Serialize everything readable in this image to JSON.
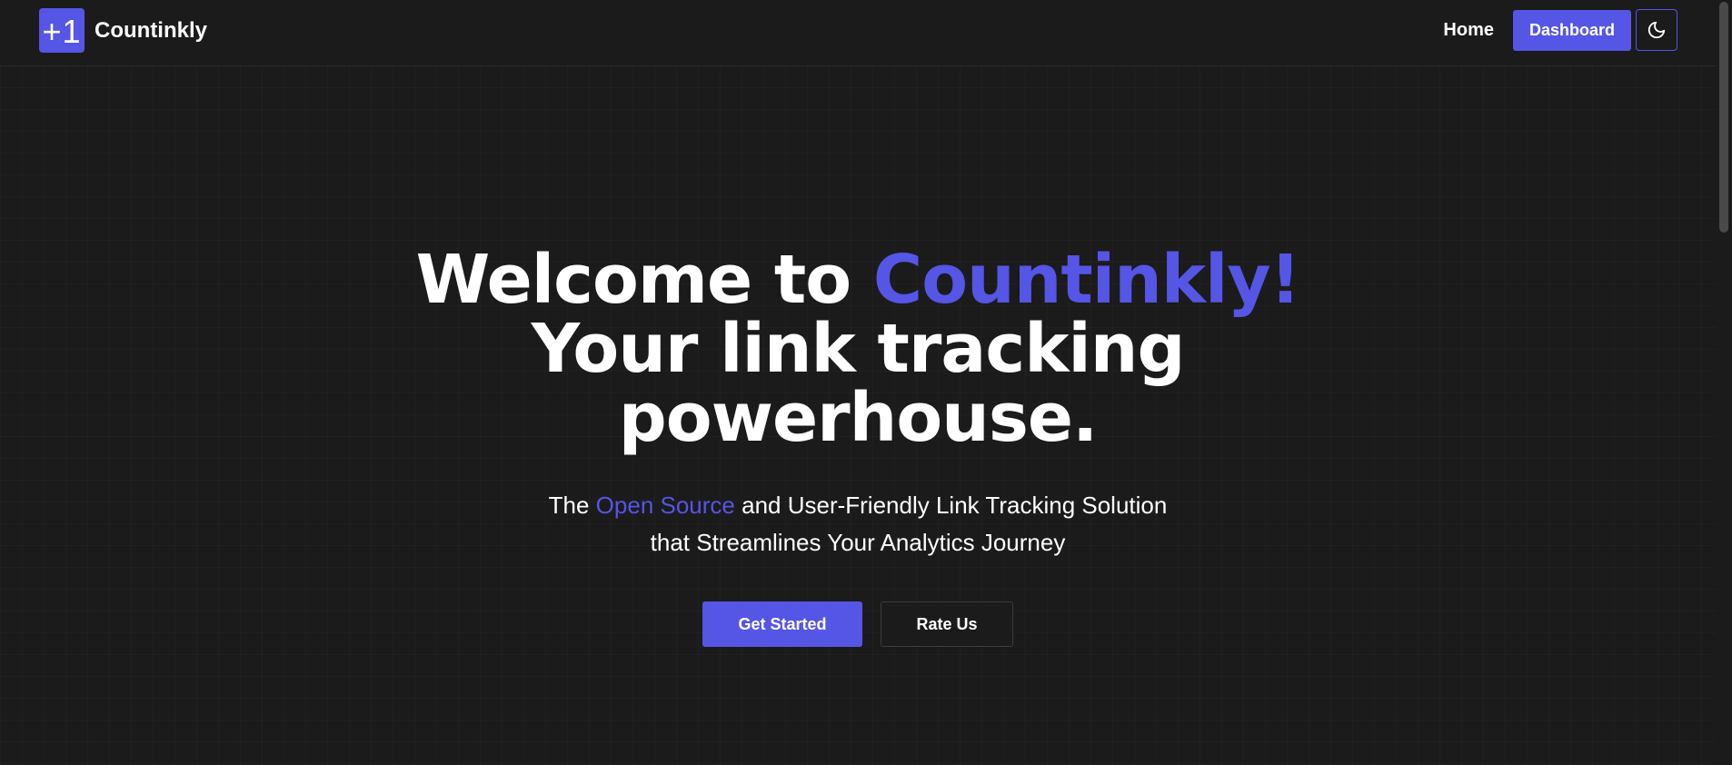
{
  "brand": {
    "logo_text": "+1",
    "name": "Countinkly"
  },
  "nav": {
    "home_label": "Home",
    "dashboard_label": "Dashboard",
    "theme_toggle_icon": "moon-icon"
  },
  "hero": {
    "title_line1_prefix": "Welcome to ",
    "title_line1_accent": "Countinkly!",
    "title_line2": "Your link tracking",
    "title_line3": "powerhouse.",
    "subtitle_prefix": "The ",
    "subtitle_accent": "Open Source",
    "subtitle_line1_suffix": " and User-Friendly Link Tracking Solution",
    "subtitle_line2": "that Streamlines Your Analytics Journey",
    "primary_button": "Get Started",
    "secondary_button": "Rate Us"
  },
  "colors": {
    "background": "#1b1b1b",
    "accent": "#5555e6",
    "text": "#ffffff"
  }
}
